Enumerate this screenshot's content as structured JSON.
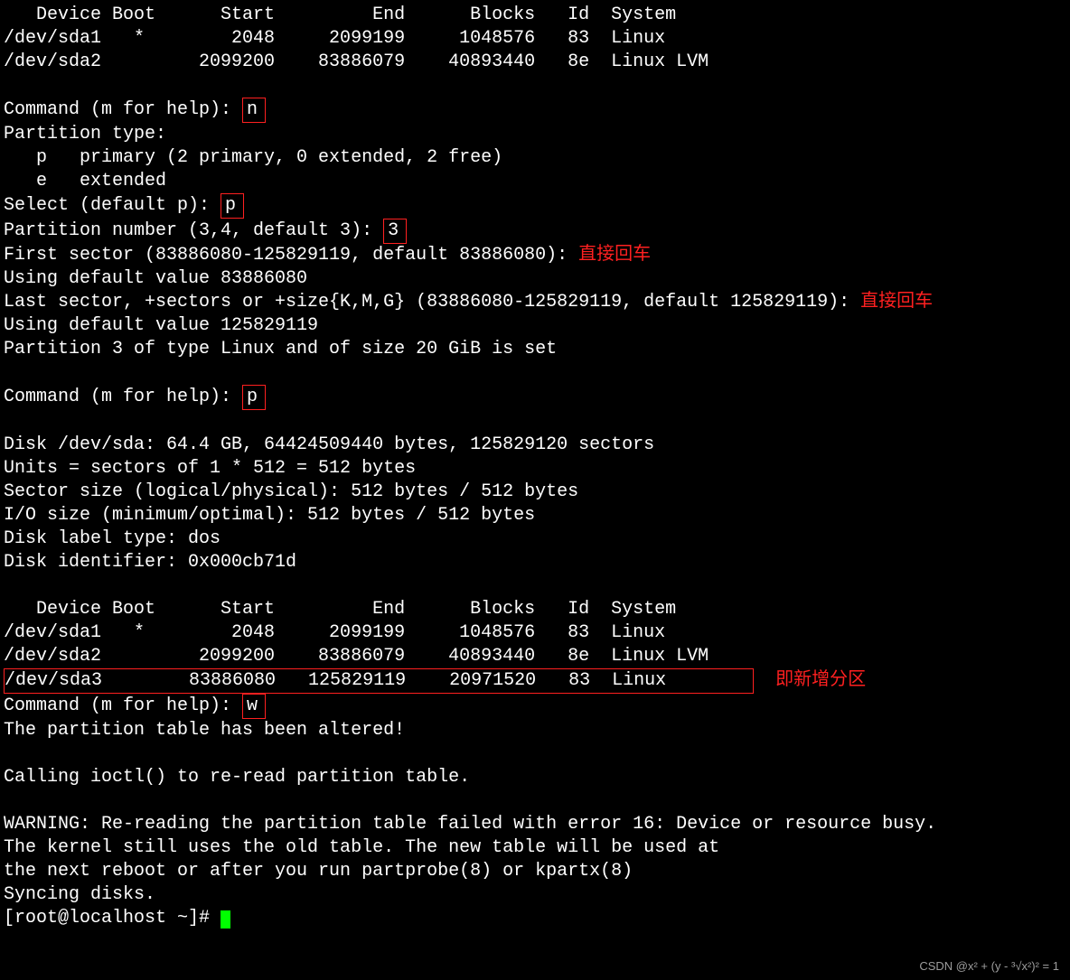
{
  "table1": {
    "header": "   Device Boot      Start         End      Blocks   Id  System",
    "rows": [
      "/dev/sda1   *        2048     2099199     1048576   83  Linux",
      "/dev/sda2         2099200    83886079    40893440   8e  Linux LVM"
    ]
  },
  "cmd1_prompt": "Command (m for help): ",
  "cmd1_input": "n",
  "ptype_header": "Partition type:",
  "ptype_p": "   p   primary (2 primary, 0 extended, 2 free)",
  "ptype_e": "   e   extended",
  "select_prompt": "Select (default p): ",
  "select_input": "p",
  "pnum_prompt": "Partition number (3,4, default 3): ",
  "pnum_input": "3",
  "first_sector_prompt": "First sector (83886080-125829119, default 83886080): ",
  "anno_enter": "直接回车",
  "using_default_1": "Using default value 83886080",
  "last_sector_prompt": "Last sector, +sectors or +size{K,M,G} (83886080-125829119, default 125829119): ",
  "using_default_2": "Using default value 125829119",
  "partition_set": "Partition 3 of type Linux and of size 20 GiB is set",
  "cmd2_input": "p",
  "disk_info": [
    "Disk /dev/sda: 64.4 GB, 64424509440 bytes, 125829120 sectors",
    "Units = sectors of 1 * 512 = 512 bytes",
    "Sector size (logical/physical): 512 bytes / 512 bytes",
    "I/O size (minimum/optimal): 512 bytes / 512 bytes",
    "Disk label type: dos",
    "Disk identifier: 0x000cb71d"
  ],
  "table2": {
    "header": "   Device Boot      Start         End      Blocks   Id  System",
    "rows": [
      "/dev/sda1   *        2048     2099199     1048576   83  Linux",
      "/dev/sda2         2099200    83886079    40893440   8e  Linux LVM"
    ],
    "new_row": "/dev/sda3        83886080   125829119    20971520   83  Linux        "
  },
  "anno_new_partition": "即新增分区",
  "cmd3_input": "w",
  "altered": "The partition table has been altered!",
  "calling_ioctl": "Calling ioctl() to re-read partition table.",
  "warning": [
    "WARNING: Re-reading the partition table failed with error 16: Device or resource busy.",
    "The kernel still uses the old table. The new table will be used at",
    "the next reboot or after you run partprobe(8) or kpartx(8)",
    "Syncing disks."
  ],
  "shell_prompt": "[root@localhost ~]# ",
  "watermark": "CSDN @x² + (y - ³√x²)² = 1"
}
